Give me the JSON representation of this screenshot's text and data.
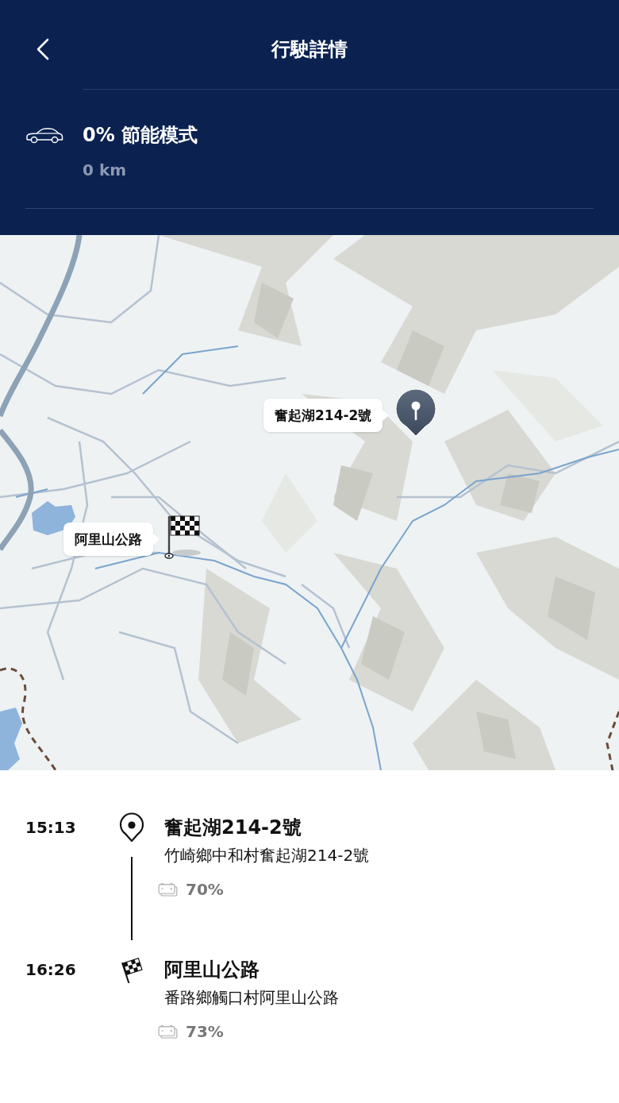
{
  "header": {
    "title": "行駛詳情"
  },
  "summary": {
    "eco_score": "0% 節能模式",
    "distance": "0 km"
  },
  "map": {
    "markers": [
      {
        "kind": "pin",
        "label": "奮起湖214-2號"
      },
      {
        "kind": "finish",
        "label": "阿里山公路"
      }
    ]
  },
  "stops": [
    {
      "kind": "pin",
      "time": "15:13",
      "name": "奮起湖214-2號",
      "address": "竹崎鄉中和村奮起湖214-2號",
      "battery": "70%"
    },
    {
      "kind": "finish",
      "time": "16:26",
      "name": "阿里山公路",
      "address": "番路鄉觸口村阿里山公路",
      "battery": "73%"
    }
  ]
}
